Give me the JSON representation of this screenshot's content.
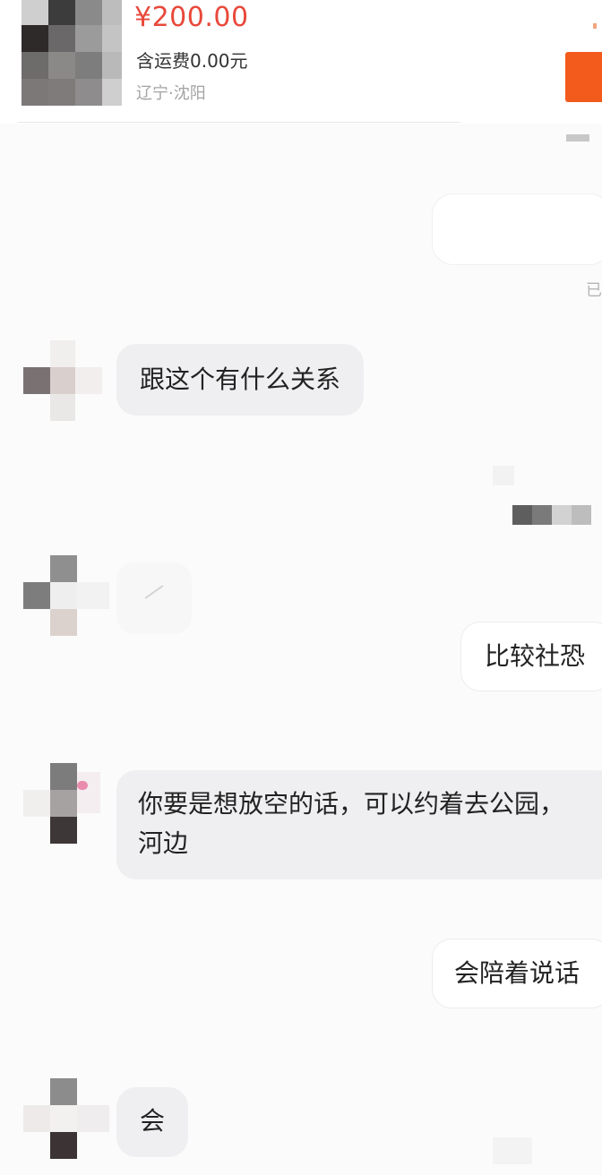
{
  "product": {
    "price": "¥200.00",
    "shipping": "含运费0.00元",
    "location": "辽宁·沈阳"
  },
  "chat": {
    "read_receipt": "已",
    "messages": [
      {
        "side": "incoming",
        "text": "跟这个有什么关系"
      },
      {
        "side": "incoming",
        "text": ""
      },
      {
        "side": "outgoing",
        "text": "比较社恐"
      },
      {
        "side": "incoming",
        "text": "你要是想放空的话，可以约着去公园，河边"
      },
      {
        "side": "outgoing",
        "text": "会陪着说话"
      },
      {
        "side": "incoming",
        "text": "会"
      }
    ]
  },
  "colors": {
    "price": "#e8483a",
    "buy_button": "#f35b1c",
    "incoming_bubble": "#efeff1",
    "outgoing_bubble": "#ffffff"
  },
  "icons": {
    "product_thumbnail": "pixelated-product-image",
    "avatar": "pixelated-avatar-icon"
  }
}
